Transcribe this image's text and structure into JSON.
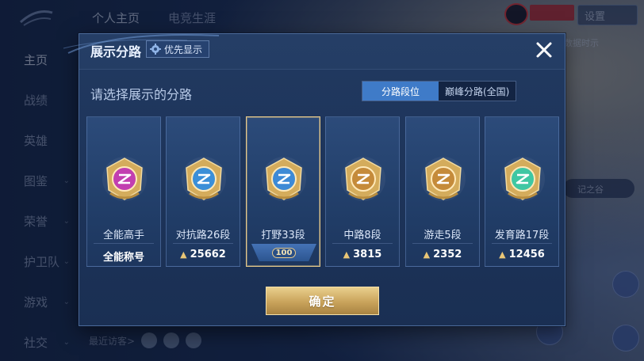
{
  "background": {
    "top_tabs": [
      "个人主页",
      "电竞生涯"
    ],
    "left_nav": [
      {
        "label": "主页",
        "chevron": false,
        "active": true
      },
      {
        "label": "战绩",
        "chevron": false,
        "active": false
      },
      {
        "label": "英雄",
        "chevron": false,
        "active": false
      },
      {
        "label": "图鉴",
        "chevron": true,
        "active": false
      },
      {
        "label": "荣誉",
        "chevron": true,
        "active": false
      },
      {
        "label": "护卫队",
        "chevron": true,
        "active": false
      },
      {
        "label": "游戏",
        "chevron": true,
        "active": false
      },
      {
        "label": "社交",
        "chevron": true,
        "active": false
      }
    ],
    "settings_label": "设置",
    "data_show_label": "和数据时示",
    "side_pill_label": "记之谷",
    "recent_visitors_label": "最近访客>"
  },
  "modal": {
    "title": "展示分路",
    "priority_label": "优先显示",
    "prompt": "请选择展示的分路",
    "tabs": [
      {
        "label": "分路段位",
        "active": true
      },
      {
        "label": "巅峰分路(全国)",
        "active": false
      }
    ],
    "cards": [
      {
        "lane": "全能高手",
        "score": "全能称号",
        "show_icon": false,
        "selected": false,
        "emblem": "allround-emblem-icon",
        "color": "#c23fb0"
      },
      {
        "lane": "对抗路26段",
        "score": "25662",
        "show_icon": true,
        "selected": false,
        "emblem": "clash-lane-emblem-icon",
        "color": "#3b8fd8"
      },
      {
        "lane": "打野33段",
        "score": "100",
        "show_icon": false,
        "selected": true,
        "emblem": "jungle-emblem-icon",
        "color": "#3d8ad6"
      },
      {
        "lane": "中路8段",
        "score": "3815",
        "show_icon": true,
        "selected": false,
        "emblem": "mid-lane-emblem-icon",
        "color": "#c58b3a"
      },
      {
        "lane": "游走5段",
        "score": "2352",
        "show_icon": true,
        "selected": false,
        "emblem": "roam-emblem-icon",
        "color": "#c58b3a"
      },
      {
        "lane": "发育路17段",
        "score": "12456",
        "show_icon": true,
        "selected": false,
        "emblem": "farm-lane-emblem-icon",
        "color": "#3fc7a3"
      }
    ],
    "confirm_label": "确定"
  }
}
